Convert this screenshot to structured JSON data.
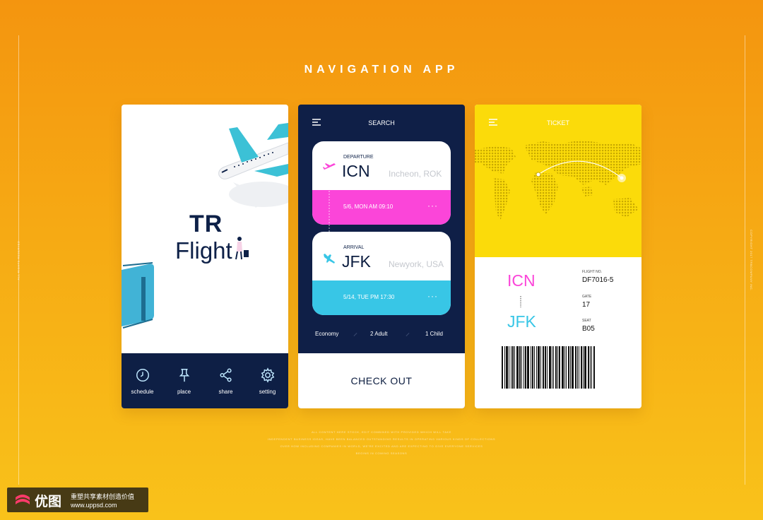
{
  "page": {
    "title": "NAVIGATION APP"
  },
  "side_left": "ALL RIGHTS RESERVED",
  "side_right": "COPYRIGHT 2017 TRBCOMPANY INC.",
  "card1": {
    "logo_line1": "TR",
    "logo_line2": "Flight",
    "nav": [
      {
        "label": "schedule",
        "icon": "clock-icon"
      },
      {
        "label": "place",
        "icon": "pin-icon"
      },
      {
        "label": "share",
        "icon": "share-icon"
      },
      {
        "label": "setting",
        "icon": "gear-icon"
      }
    ]
  },
  "card2": {
    "header_title": "SEARCH",
    "departure": {
      "label": "DEPARTURE",
      "code": "ICN",
      "city": "Incheon, ROK",
      "datetime": "5/6, MON  AM 09:10",
      "more": "···"
    },
    "arrival": {
      "label": "ARRIVAL",
      "code": "JFK",
      "city": "Newyork, USA",
      "datetime": "5/14, TUE  PM 17:30",
      "more": "···"
    },
    "passengers": {
      "class": "Economy",
      "adult": "2 Adult",
      "child": "1 Child"
    },
    "checkout": "CHECK OUT"
  },
  "card3": {
    "header_title": "TICKET",
    "from_code": "ICN",
    "to_code": "JFK",
    "flight_no_label": "FLIGHT NO.",
    "flight_no": "DF7016-5",
    "gate_label": "GATE",
    "gate": "17",
    "seat_label": "SEAT",
    "seat": "B05"
  },
  "footnote": [
    "ALL CONTENT HERE STOCK, EDIT COMBINED WITH PROVIDED WHICH WILL TAKE",
    "INDEPENDENT BUSINESS IDEAS, HAVE BEEN BALANCED OUTSTANDING RESULTS IN OPERATING VARIOUS KINDS OF COLLECTIONS",
    "OVER HOW INCLUDING COMPANIES IN WORLD, WE'RE EXCITED AND ARE EXPECTING TO GIVE EVERYONE SERVICES",
    "BEGINS IN COMING SEASONS"
  ],
  "watermark": {
    "brand": "优图",
    "slogan": "重塑共享素材创造价值",
    "url": "www.uppsd.com"
  },
  "colors": {
    "navy": "#0f1f47",
    "pink": "#fb45d9",
    "cyan": "#38c6e6",
    "yellow": "#fbdb0a"
  }
}
